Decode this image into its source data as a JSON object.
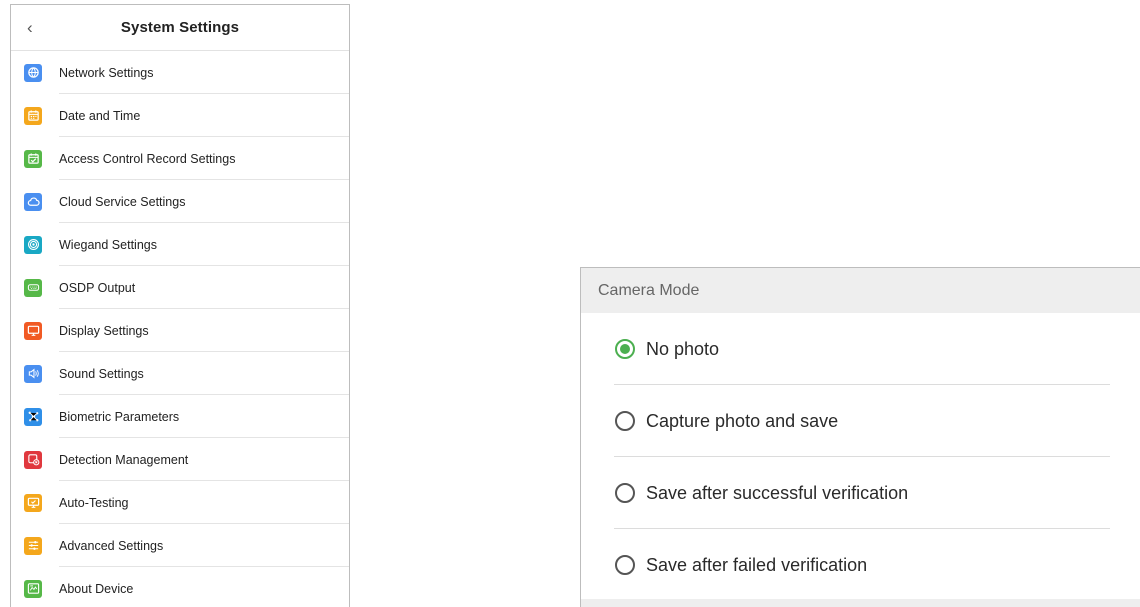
{
  "left_panel": {
    "back_icon": "‹",
    "title": "System Settings",
    "items": [
      {
        "label": "Network Settings",
        "icon": "globe-icon",
        "color": "#4a8ff0"
      },
      {
        "label": "Date and Time",
        "icon": "calendar-icon",
        "color": "#f4a71c"
      },
      {
        "label": "Access Control Record Settings",
        "icon": "calendar-check-icon",
        "color": "#56b848"
      },
      {
        "label": "Cloud Service Settings",
        "icon": "cloud-icon",
        "color": "#4a8ff0"
      },
      {
        "label": "Wiegand Settings",
        "icon": "target-icon",
        "color": "#19a8c4"
      },
      {
        "label": "OSDP Output",
        "icon": "port-icon",
        "color": "#56b848"
      },
      {
        "label": "Display Settings",
        "icon": "monitor-icon",
        "color": "#f15a24"
      },
      {
        "label": "Sound Settings",
        "icon": "speaker-icon",
        "color": "#4a8ff0"
      },
      {
        "label": "Biometric Parameters",
        "icon": "nodes-icon",
        "color": "#2f8fe8"
      },
      {
        "label": "Detection Management",
        "icon": "detection-icon",
        "color": "#e0383e"
      },
      {
        "label": "Auto-Testing",
        "icon": "test-monitor-icon",
        "color": "#f4a71c"
      },
      {
        "label": "Advanced Settings",
        "icon": "sliders-icon",
        "color": "#f4a71c"
      },
      {
        "label": "About Device",
        "icon": "device-info-icon",
        "color": "#56b848"
      }
    ]
  },
  "dialog": {
    "title": "Camera Mode",
    "accent_color": "#4caf50",
    "options": [
      {
        "label": "No photo",
        "selected": true
      },
      {
        "label": "Capture photo and save",
        "selected": false
      },
      {
        "label": "Save after successful verification",
        "selected": false
      },
      {
        "label": "Save after failed verification",
        "selected": false
      }
    ]
  }
}
